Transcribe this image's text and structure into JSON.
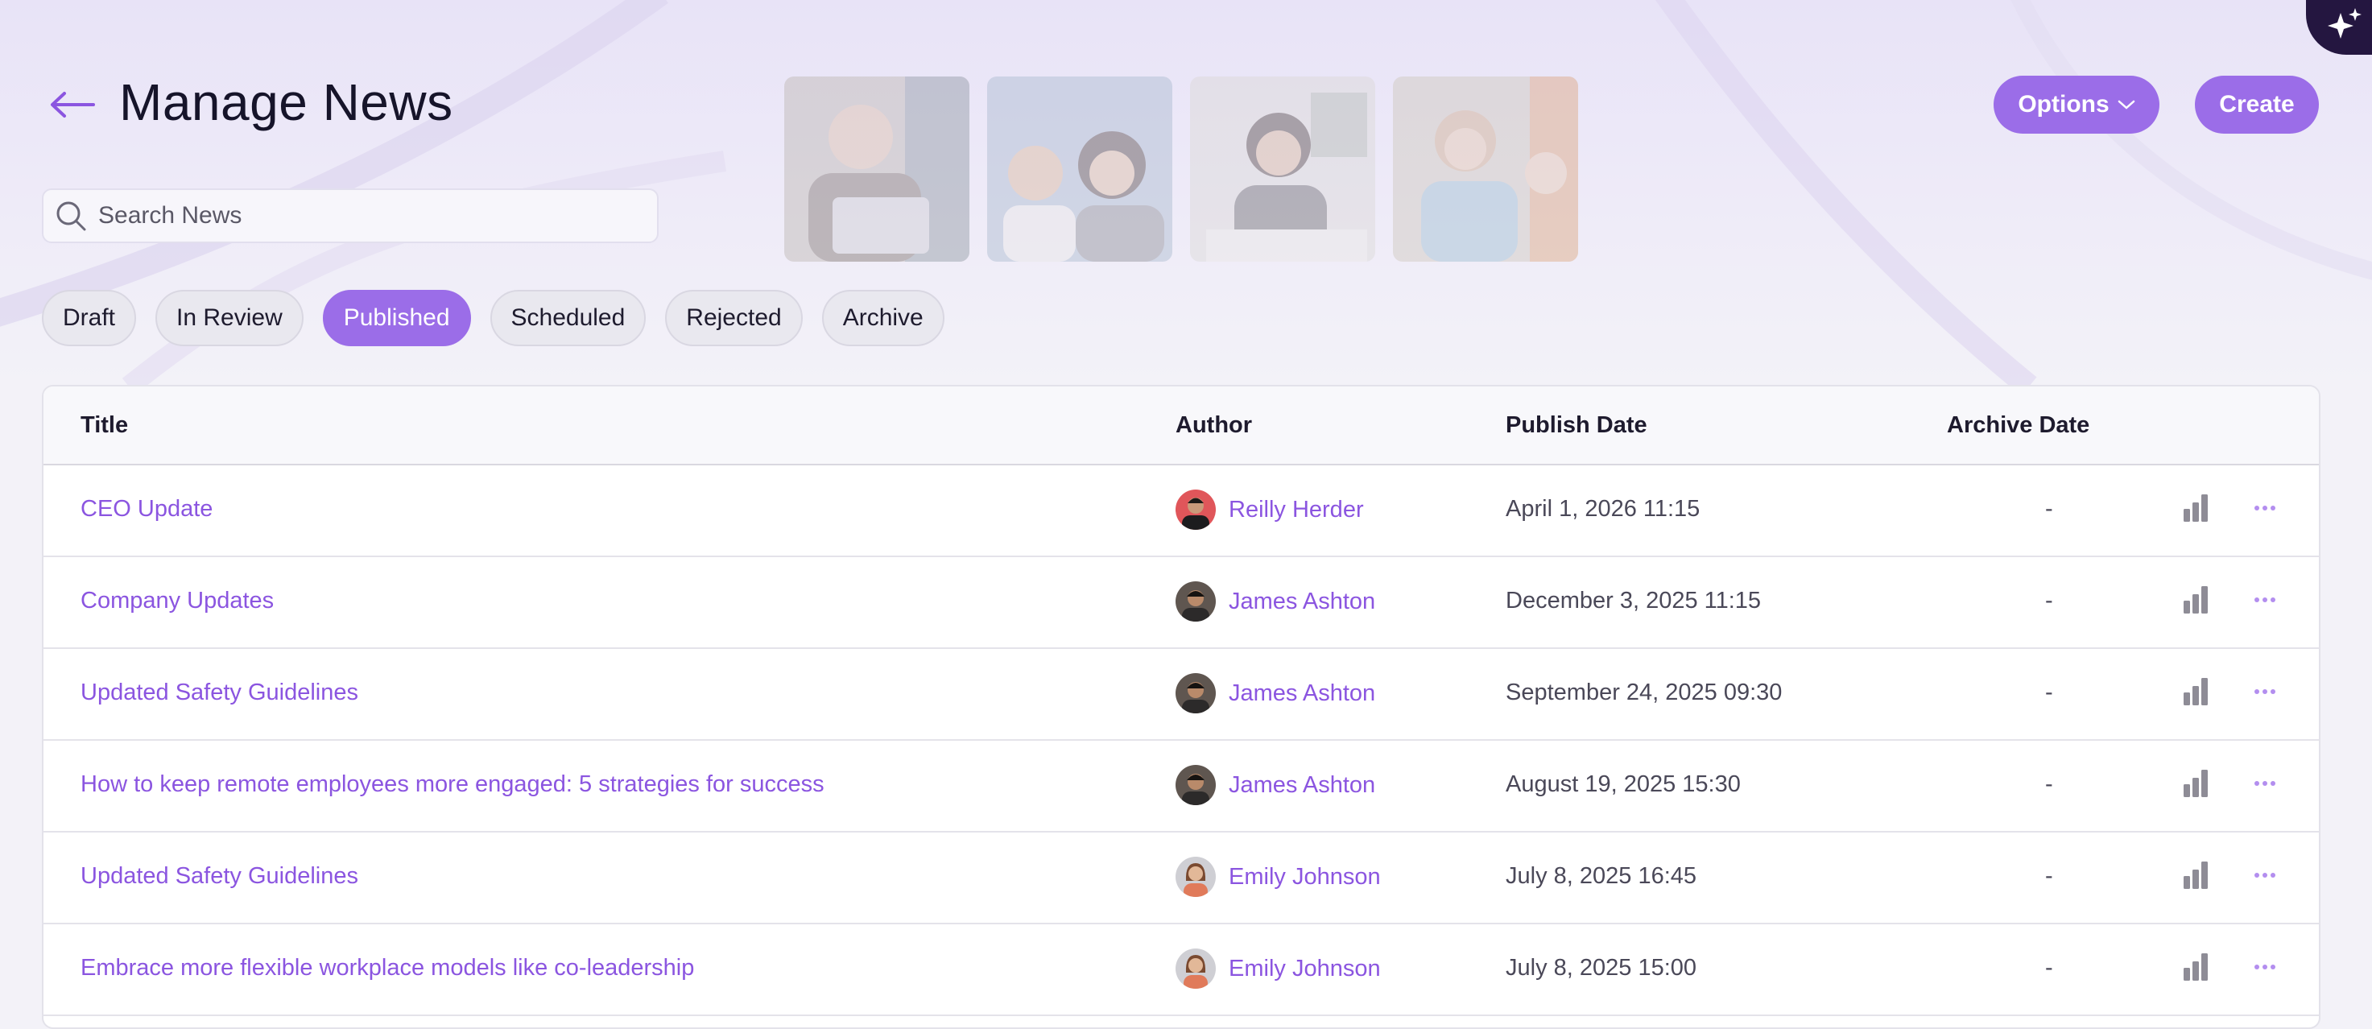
{
  "header": {
    "title": "Manage News",
    "back_icon": "arrow-left-icon",
    "options_label": "Options",
    "create_label": "Create",
    "assistant_icon": "sparkle-icon"
  },
  "search": {
    "placeholder": "Search News",
    "value": ""
  },
  "tabs": [
    {
      "label": "Draft",
      "active": false
    },
    {
      "label": "In Review",
      "active": false
    },
    {
      "label": "Published",
      "active": true
    },
    {
      "label": "Scheduled",
      "active": false
    },
    {
      "label": "Rejected",
      "active": false
    },
    {
      "label": "Archive",
      "active": false
    }
  ],
  "table": {
    "columns": {
      "title": "Title",
      "author": "Author",
      "publish_date": "Publish Date",
      "archive_date": "Archive Date"
    },
    "rows": [
      {
        "title": "CEO Update",
        "author": "Reilly Herder",
        "publish_date": "April 1, 2026 11:15",
        "archive_date": "-"
      },
      {
        "title": "Company Updates",
        "author": "James Ashton",
        "publish_date": "December 3, 2025 11:15",
        "archive_date": "-"
      },
      {
        "title": "Updated Safety Guidelines",
        "author": "James Ashton",
        "publish_date": "September 24, 2025 09:30",
        "archive_date": "-"
      },
      {
        "title": "How to keep remote employees more engaged: 5 strategies for success",
        "author": "James Ashton",
        "publish_date": "August 19, 2025 15:30",
        "archive_date": "-"
      },
      {
        "title": "Updated Safety Guidelines",
        "author": "Emily Johnson",
        "publish_date": "July 8, 2025 16:45",
        "archive_date": "-"
      },
      {
        "title": "Embrace more flexible workplace models like co-leadership",
        "author": "Emily Johnson",
        "publish_date": "July 8, 2025 15:00",
        "archive_date": "-"
      }
    ]
  },
  "colors": {
    "accent": "#9b6de8",
    "link": "#8b55e0",
    "assistant_bg": "#241640"
  }
}
